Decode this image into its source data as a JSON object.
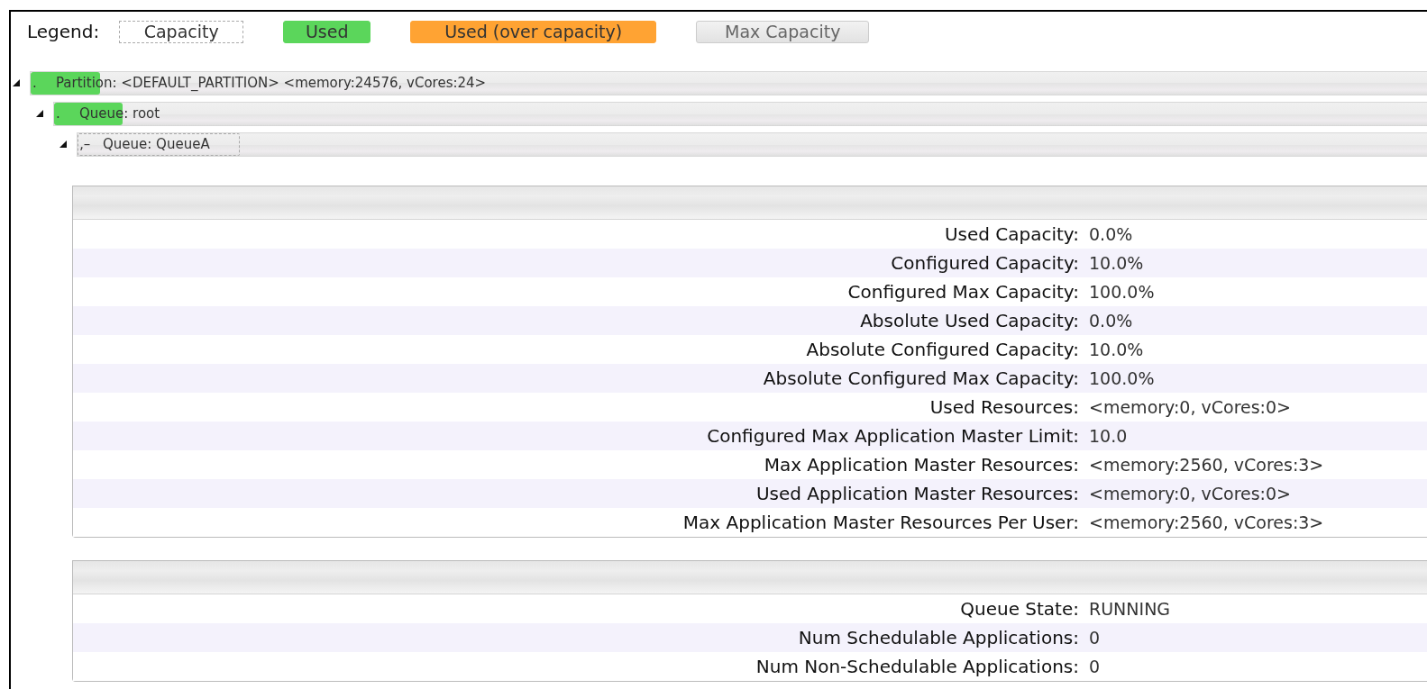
{
  "legend": {
    "title": "Legend:",
    "items": [
      {
        "kind": "capacity",
        "label": "Capacity"
      },
      {
        "kind": "used",
        "label": "Used"
      },
      {
        "kind": "over",
        "label": "Used (over capacity)"
      },
      {
        "kind": "max",
        "label": "Max Capacity"
      }
    ]
  },
  "tree": [
    {
      "expanded": true,
      "prefix": ".",
      "label": "Partition: <DEFAULT_PARTITION> <memory:24576, vCores:24>",
      "used": {
        "level": 0.05
      },
      "children": [
        {
          "expanded": true,
          "prefix": ".",
          "label": "Queue: root",
          "used": {
            "level": 0.05
          },
          "children": [
            {
              "expanded": true,
              "prefix": "‚–",
              "label": "Queue: QueueA",
              "capacity": {
                "level": 0.12
              }
            }
          ]
        }
      ]
    }
  ],
  "panels": [
    {
      "rows": [
        {
          "key": "Used Capacity:",
          "value": "0.0%"
        },
        {
          "key": "Configured Capacity:",
          "value": "10.0%"
        },
        {
          "key": "Configured Max Capacity:",
          "value": "100.0%"
        },
        {
          "key": "Absolute Used Capacity:",
          "value": "0.0%"
        },
        {
          "key": "Absolute Configured Capacity:",
          "value": "10.0%"
        },
        {
          "key": "Absolute Configured Max Capacity:",
          "value": "100.0%"
        },
        {
          "key": "Used Resources:",
          "value": "<memory:0, vCores:0>"
        },
        {
          "key": "Configured Max Application Master Limit:",
          "value": "10.0"
        },
        {
          "key": "Max Application Master Resources:",
          "value": "<memory:2560, vCores:3>"
        },
        {
          "key": "Used Application Master Resources:",
          "value": "<memory:0, vCores:0>"
        },
        {
          "key": "Max Application Master Resources Per User:",
          "value": "<memory:2560, vCores:3>"
        }
      ]
    },
    {
      "rows": [
        {
          "key": "Queue State:",
          "value": "RUNNING"
        },
        {
          "key": "Num Schedulable Applications:",
          "value": "0"
        },
        {
          "key": "Num Non-Schedulable Applications:",
          "value": "0"
        }
      ]
    }
  ]
}
